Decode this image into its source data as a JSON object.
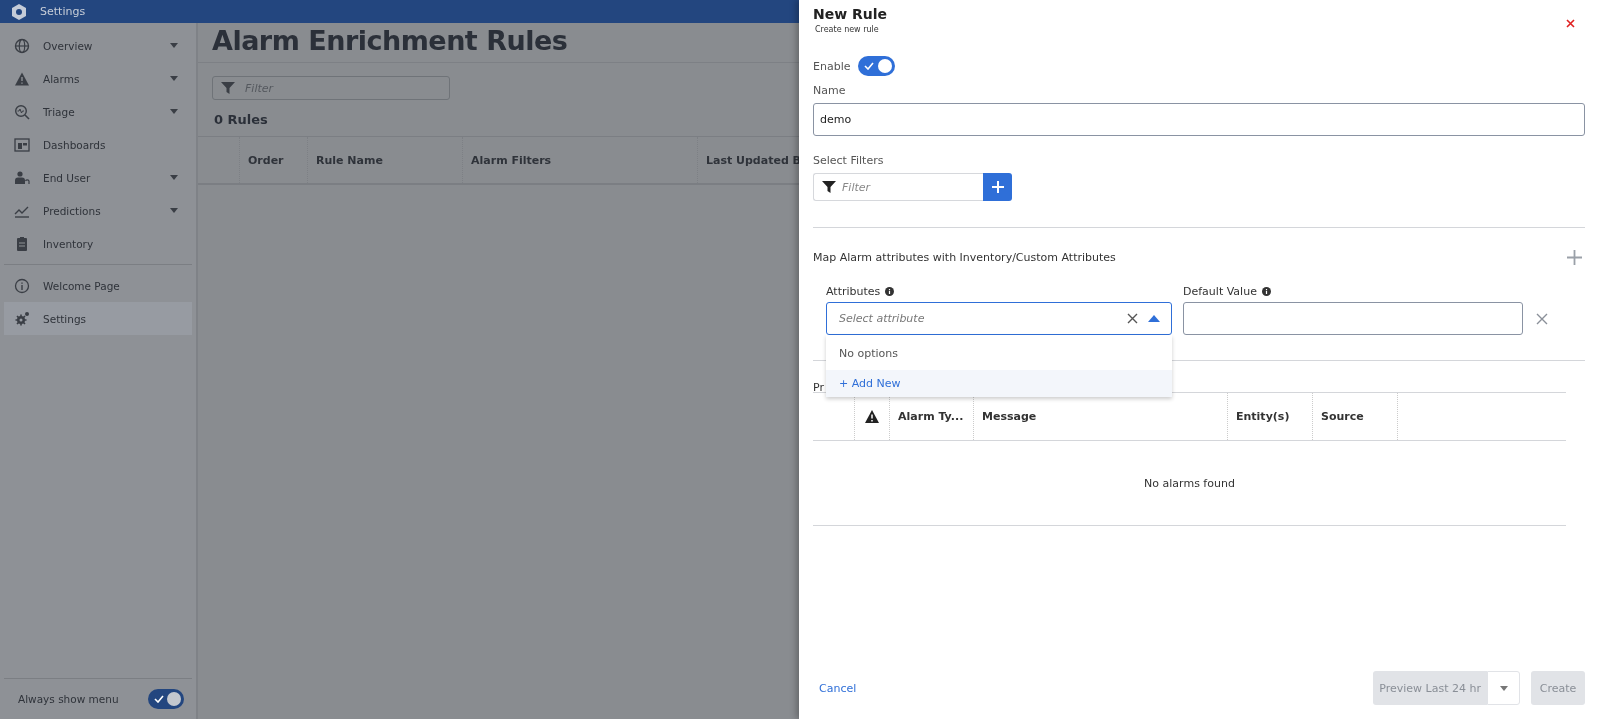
{
  "app_bar": {
    "title": "Settings"
  },
  "sidebar": {
    "items": [
      {
        "label": "Overview",
        "expandable": true,
        "selected": false
      },
      {
        "label": "Alarms",
        "expandable": true,
        "selected": false
      },
      {
        "label": "Triage",
        "expandable": true,
        "selected": false
      },
      {
        "label": "Dashboards",
        "expandable": false,
        "selected": false
      },
      {
        "label": "End User",
        "expandable": true,
        "selected": false
      },
      {
        "label": "Predictions",
        "expandable": true,
        "selected": false
      },
      {
        "label": "Inventory",
        "expandable": false,
        "selected": false
      },
      {
        "label": "Welcome Page",
        "expandable": false,
        "selected": false
      },
      {
        "label": "Settings",
        "expandable": false,
        "selected": true
      }
    ],
    "always_show_menu": {
      "label": "Always show menu",
      "on": true
    }
  },
  "main": {
    "title": "Alarm Enrichment Rules",
    "filter": {
      "placeholder": "Filter"
    },
    "count": "0 Rules",
    "table": {
      "columns": [
        "Order",
        "Rule Name",
        "Alarm Filters",
        "Last Updated B"
      ]
    }
  },
  "panel": {
    "title": "New Rule",
    "subtitle": "Create new rule",
    "enable": {
      "label": "Enable",
      "on": true
    },
    "name": {
      "label": "Name",
      "value": "demo"
    },
    "filters": {
      "label": "Select Filters",
      "placeholder": "Filter"
    },
    "mapping": {
      "title": "Map Alarm attributes with Inventory/Custom Attributes",
      "attributes_label": "Attributes",
      "default_label": "Default Value",
      "select_placeholder": "Select attribute",
      "expanded": true,
      "dropdown": {
        "empty_text": "No options",
        "add_new": "+ Add New"
      }
    },
    "preview": {
      "label": "Pr",
      "columns": [
        "Alarm Ty...",
        "Message",
        "Entity(s)",
        "Source"
      ],
      "empty": "No alarms found"
    },
    "footer": {
      "cancel": "Cancel",
      "preview_button": {
        "label": "Preview Last 24 hr",
        "disabled": true
      },
      "create": {
        "label": "Create",
        "disabled": true
      }
    }
  }
}
